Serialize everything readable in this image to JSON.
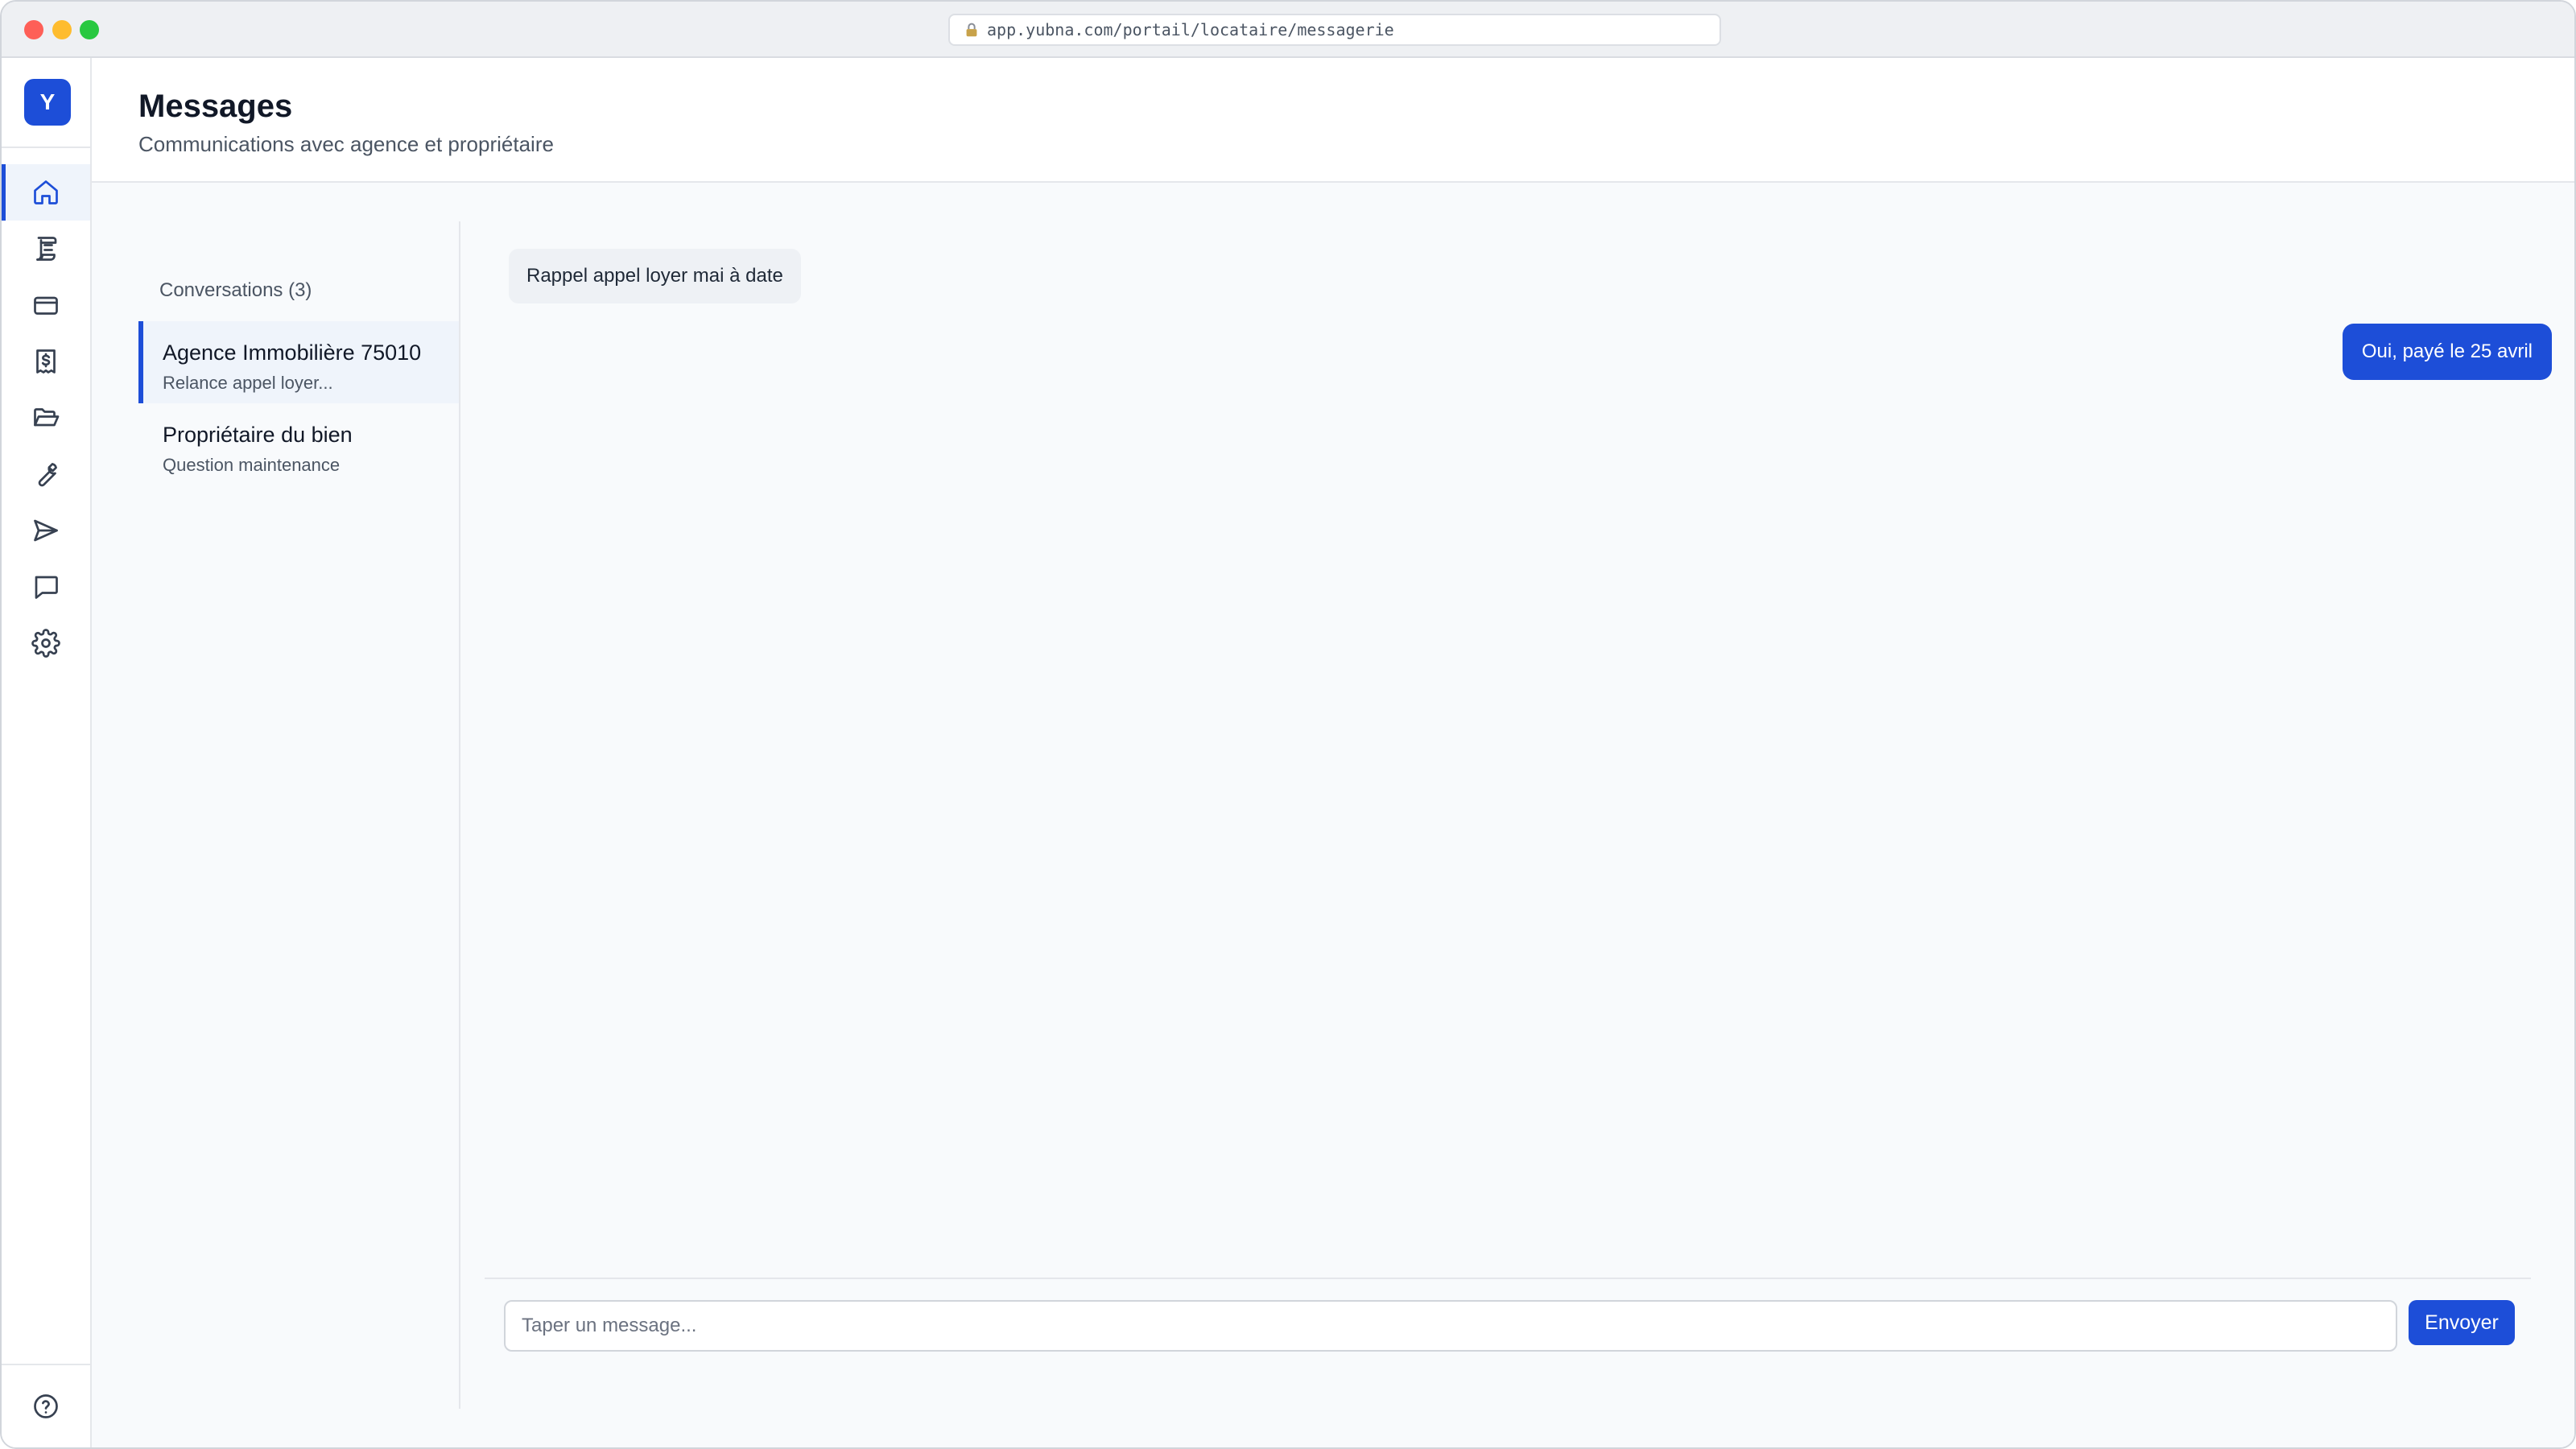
{
  "browser": {
    "url": "app.yubna.com/portail/locataire/messagerie"
  },
  "brand": {
    "letter": "Y"
  },
  "nav": {
    "items": [
      {
        "icon": "home-icon",
        "active": true
      },
      {
        "icon": "lease-document-icon",
        "active": false
      },
      {
        "icon": "credit-card-icon",
        "active": false
      },
      {
        "icon": "receipt-dollar-icon",
        "active": false
      },
      {
        "icon": "folder-open-icon",
        "active": false
      },
      {
        "icon": "wrench-icon",
        "active": false
      },
      {
        "icon": "send-icon",
        "active": false
      },
      {
        "icon": "message-icon",
        "active": false
      },
      {
        "icon": "settings-gear-icon",
        "active": false
      }
    ],
    "bottom_icon": "help-circle-icon"
  },
  "header": {
    "title": "Messages",
    "subtitle": "Communications avec agence et propriétaire"
  },
  "conversations": {
    "heading": "Conversations (3)",
    "items": [
      {
        "name": "Agence Immobilière 75010",
        "preview": "Relance appel loyer...",
        "active": true
      },
      {
        "name": "Propriétaire du bien",
        "preview": "Question maintenance",
        "active": false
      }
    ]
  },
  "thread": {
    "messages": [
      {
        "direction": "incoming",
        "text": "Rappel appel loyer mai à date"
      },
      {
        "direction": "outgoing",
        "text": "Oui, payé le 25 avril"
      }
    ]
  },
  "composer": {
    "placeholder": "Taper un message...",
    "value": "",
    "send_label": "Envoyer"
  },
  "colors": {
    "accent": "#1d4ed8",
    "active_bg": "#eff4fb",
    "content_bg": "#f8fafc",
    "incoming_bubble": "#eef1f5"
  }
}
